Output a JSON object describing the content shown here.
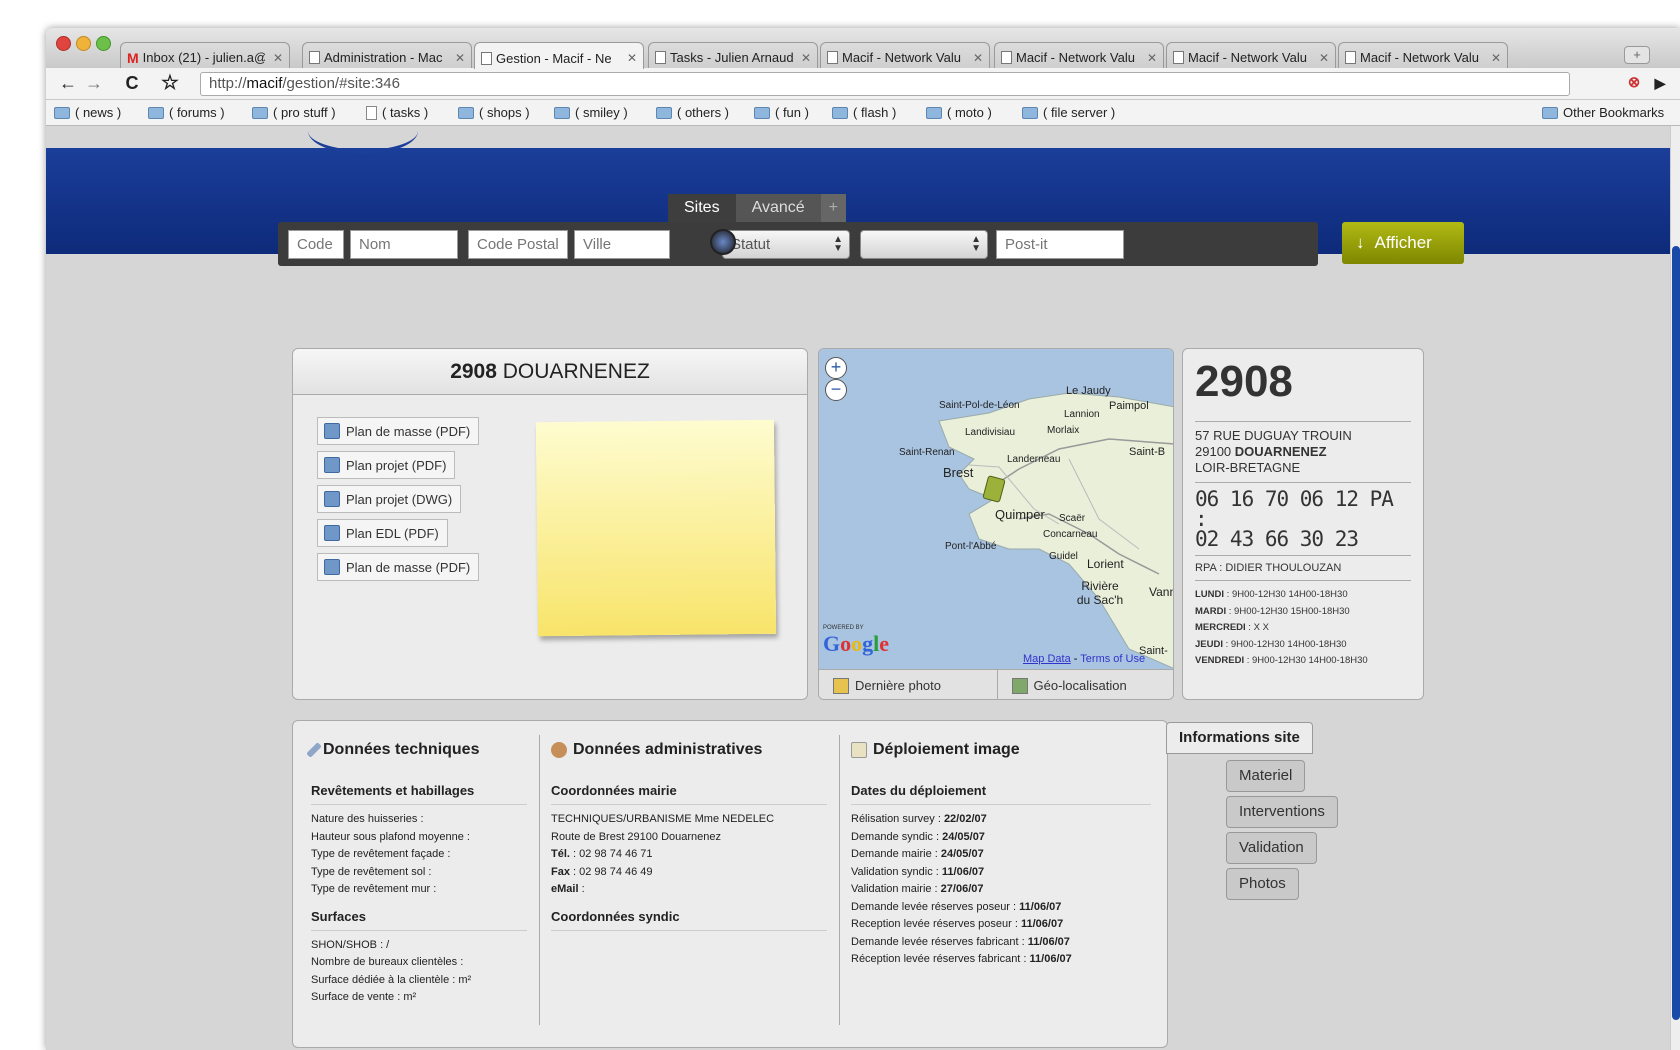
{
  "browser": {
    "tabs": [
      {
        "title": "Inbox (21) - julien.a@",
        "icon": "gmail-icon"
      },
      {
        "title": "Administration - Mac",
        "icon": "page-icon"
      },
      {
        "title": "Gestion - Macif - Ne",
        "icon": "page-icon",
        "active": true
      },
      {
        "title": "Tasks - Julien Arnaud",
        "icon": "page-icon"
      },
      {
        "title": "Macif - Network Valu",
        "icon": "page-icon"
      },
      {
        "title": "Macif - Network Valu",
        "icon": "page-icon"
      },
      {
        "title": "Macif - Network Valu",
        "icon": "page-icon"
      },
      {
        "title": "Macif - Network Valu",
        "icon": "page-icon"
      }
    ],
    "url_prefix": "http://",
    "url_host": "macif",
    "url_path": "/gestion/#site:346",
    "bookmarks": [
      {
        "label": "( news )",
        "type": "folder"
      },
      {
        "label": "( forums )",
        "type": "folder"
      },
      {
        "label": "( pro stuff )",
        "type": "folder"
      },
      {
        "label": "( tasks )",
        "type": "page"
      },
      {
        "label": "( shops )",
        "type": "folder"
      },
      {
        "label": "( smiley )",
        "type": "folder"
      },
      {
        "label": "( others )",
        "type": "folder"
      },
      {
        "label": "( fun )",
        "type": "folder"
      },
      {
        "label": "( flash )",
        "type": "folder"
      },
      {
        "label": "( moto )",
        "type": "folder"
      },
      {
        "label": "( file server )",
        "type": "folder"
      }
    ],
    "other_bookmarks": "Other Bookmarks"
  },
  "search": {
    "tabs": [
      "Sites",
      "Avancé",
      "+"
    ],
    "code_placeholder": "Code",
    "nom_placeholder": "Nom",
    "cp_placeholder": "Code Postal",
    "ville_placeholder": "Ville",
    "statut": "Statut",
    "second_select": "",
    "postit_placeholder": "Post-it",
    "submit": "Afficher"
  },
  "site": {
    "code": "2908",
    "name": "DOUARNENEZ",
    "documents": [
      "Plan de masse (PDF)",
      "Plan projet (PDF)",
      "Plan projet (DWG)",
      "Plan EDL (PDF)",
      "Plan de masse (PDF)"
    ]
  },
  "map": {
    "labels": [
      "Le Jaudy",
      "Paimpol",
      "Saint-Pol-de-Léon",
      "Lannion",
      "Landivisiau",
      "Morlaix",
      "Saint-Renan",
      "Landerneau",
      "Saint-B",
      "Brest",
      "Quimper",
      "Scaër",
      "Concarneau",
      "Pont-l'Abbé",
      "Guidel",
      "Lorient",
      "Rivière du Sac'h",
      "Vann",
      "Saint-"
    ],
    "powered_by": "POWERED BY",
    "google": "Google",
    "map_data": "Map Data",
    "terms_sep": "-",
    "terms": "Terms of Use",
    "zoom_in": "+",
    "zoom_out": "−",
    "last_photo": "Dernière photo",
    "geoloc": "Géo-localisation"
  },
  "info": {
    "code": "2908",
    "street": "57 RUE DUGUAY TROUIN",
    "postal": "29100",
    "city": "DOUARNENEZ",
    "region": "LOIR-BRETAGNE",
    "phone_line1": "06 16 70 06 12 PA :",
    "phone_line2": "02 43 66 30 23",
    "rpa": "RPA : DIDIER THOULOUZAN",
    "hours": [
      {
        "day": "LUNDI",
        "value": " : 9H00-12H30 14H00-18H30"
      },
      {
        "day": "MARDI",
        "value": " : 9H00-12H30 15H00-18H30"
      },
      {
        "day": "MERCREDI",
        "value": " : X X"
      },
      {
        "day": "JEUDI",
        "value": " : 9H00-12H30 14H00-18H30"
      },
      {
        "day": "VENDREDI",
        "value": " : 9H00-12H30 14H00-18H30"
      }
    ]
  },
  "details": {
    "tech": {
      "title": "Données techniques",
      "sec1": "Revêtements et habillages",
      "sec1_lines": [
        "Nature des huisseries :",
        "Hauteur sous plafond moyenne :",
        "Type de revêtement façade :",
        "Type de revêtement sol :",
        "Type de revêtement mur :"
      ],
      "sec2": "Surfaces",
      "sec2_lines": [
        "SHON/SHOB : /",
        "Nombre de bureaux clientèles :",
        "Surface dédiée à la clientèle : m²",
        "Surface de vente : m²"
      ]
    },
    "admin": {
      "title": "Données administratives",
      "sec1": "Coordonnées mairie",
      "contact": "TECHNIQUES/URBANISME Mme NEDELEC",
      "address": "Route de Brest 29100 Douarnenez",
      "tel_label": "Tél.",
      "tel": " : 02 98 74 46 71",
      "fax_label": "Fax",
      "fax": " : 02 98 74 46 49",
      "email_label": "eMail",
      "email": " :",
      "sec2": "Coordonnées syndic"
    },
    "deploy": {
      "title": "Déploiement image",
      "sec1": "Dates du déploiement",
      "rows": [
        {
          "label": "Rélisation survey : ",
          "date": "22/02/07"
        },
        {
          "label": "Demande syndic : ",
          "date": "24/05/07"
        },
        {
          "label": "Demande mairie : ",
          "date": "24/05/07"
        },
        {
          "label": "Validation syndic : ",
          "date": "11/06/07"
        },
        {
          "label": "Validation mairie : ",
          "date": "27/06/07"
        },
        {
          "label": "Demande levée réserves poseur : ",
          "date": "11/06/07"
        },
        {
          "label": "Reception levée réserves poseur : ",
          "date": "11/06/07"
        },
        {
          "label": "Demande levée réserves fabricant : ",
          "date": "11/06/07"
        },
        {
          "label": "Réception levée réserves fabricant : ",
          "date": "11/06/07"
        }
      ]
    }
  },
  "side_tabs": [
    "Informations site",
    "Materiel",
    "Interventions",
    "Validation",
    "Photos"
  ]
}
